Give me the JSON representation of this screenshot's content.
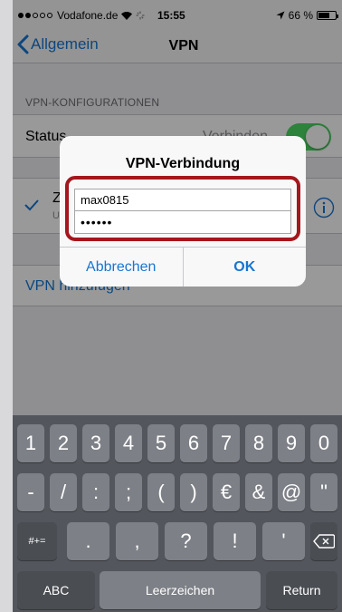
{
  "status_bar": {
    "carrier": "Vodafone.de",
    "time": "15:55",
    "battery": "66 %",
    "battery_level": 0.66
  },
  "nav": {
    "back_label": "Allgemein",
    "title": "VPN"
  },
  "settings": {
    "section_header": "VPN-KONFIGURATIONEN",
    "status_label": "Status",
    "status_value": "Verbinden",
    "config_name": "Z",
    "config_sub": "U",
    "add_vpn": "VPN hinzufügen"
  },
  "alert": {
    "title": "VPN-Verbindung",
    "username": "max0815",
    "password": "••••••",
    "cancel": "Abbrechen",
    "ok": "OK"
  },
  "keyboard": {
    "row1": [
      "1",
      "2",
      "3",
      "4",
      "5",
      "6",
      "7",
      "8",
      "9",
      "0"
    ],
    "row2": [
      "-",
      "/",
      ":",
      ";",
      "(",
      ")",
      "€",
      "&",
      "@",
      "\""
    ],
    "row3_left": "#+=",
    "row3": [
      ".",
      ",",
      "?",
      "!",
      "'"
    ],
    "abc": "ABC",
    "space": "Leerzeichen",
    "return": "Return"
  },
  "colors": {
    "accent": "#1776d2",
    "toggle_on": "#4cd964",
    "highlight": "#a5161d"
  }
}
